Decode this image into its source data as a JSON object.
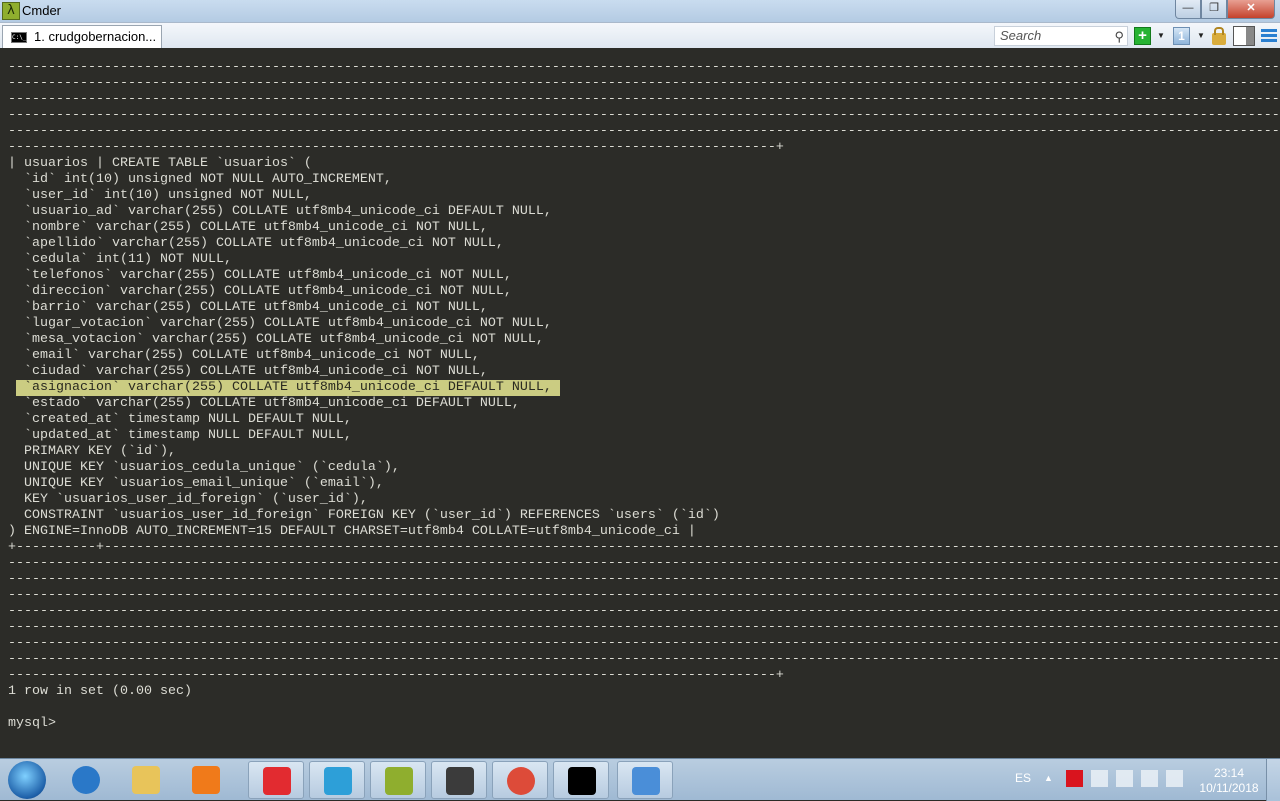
{
  "window": {
    "title": "Cmder",
    "app_icon": "lambda-icon",
    "minimize": "—",
    "maximize": "❐",
    "close": "✕"
  },
  "tabs": [
    {
      "label": "1. crudgobernacion...",
      "icon": "console-icon"
    }
  ],
  "toolbar": {
    "search_placeholder": "Search",
    "search_icon": "⚲",
    "new_console": "+",
    "console_number": "1",
    "caret": "▼"
  },
  "terminal": {
    "highlighted_line": 20,
    "selection_color": "#cbcc82",
    "lines": [
      "----------------------------------------------------------------------------------------------------------------------------------------------------------------",
      "----------------------------------------------------------------------------------------------------------------------------------------------------------------",
      "----------------------------------------------------------------------------------------------------------------------------------------------------------------",
      "----------------------------------------------------------------------------------------------------------------------------------------------------------------",
      "----------------------------------------------------------------------------------------------------------------------------------------------------------------",
      "------------------------------------------------------------------------------------------------+",
      "| usuarios | CREATE TABLE `usuarios` (",
      "  `id` int(10) unsigned NOT NULL AUTO_INCREMENT,",
      "  `user_id` int(10) unsigned NOT NULL,",
      "  `usuario_ad` varchar(255) COLLATE utf8mb4_unicode_ci DEFAULT NULL,",
      "  `nombre` varchar(255) COLLATE utf8mb4_unicode_ci NOT NULL,",
      "  `apellido` varchar(255) COLLATE utf8mb4_unicode_ci NOT NULL,",
      "  `cedula` int(11) NOT NULL,",
      "  `telefonos` varchar(255) COLLATE utf8mb4_unicode_ci NOT NULL,",
      "  `direccion` varchar(255) COLLATE utf8mb4_unicode_ci NOT NULL,",
      "  `barrio` varchar(255) COLLATE utf8mb4_unicode_ci NOT NULL,",
      "  `lugar_votacion` varchar(255) COLLATE utf8mb4_unicode_ci NOT NULL,",
      "  `mesa_votacion` varchar(255) COLLATE utf8mb4_unicode_ci NOT NULL,",
      "  `email` varchar(255) COLLATE utf8mb4_unicode_ci NOT NULL,",
      "  `ciudad` varchar(255) COLLATE utf8mb4_unicode_ci NOT NULL,",
      "  `asignacion` varchar(255) COLLATE utf8mb4_unicode_ci DEFAULT NULL,",
      "  `estado` varchar(255) COLLATE utf8mb4_unicode_ci DEFAULT NULL,",
      "  `created_at` timestamp NULL DEFAULT NULL,",
      "  `updated_at` timestamp NULL DEFAULT NULL,",
      "  PRIMARY KEY (`id`),",
      "  UNIQUE KEY `usuarios_cedula_unique` (`cedula`),",
      "  UNIQUE KEY `usuarios_email_unique` (`email`),",
      "  KEY `usuarios_user_id_foreign` (`user_id`),",
      "  CONSTRAINT `usuarios_user_id_foreign` FOREIGN KEY (`user_id`) REFERENCES `users` (`id`)",
      ") ENGINE=InnoDB AUTO_INCREMENT=15 DEFAULT CHARSET=utf8mb4 COLLATE=utf8mb4_unicode_ci |",
      "+----------+-----------------------------------------------------------------------------------------------------------------------------------------------------",
      "----------------------------------------------------------------------------------------------------------------------------------------------------------------",
      "----------------------------------------------------------------------------------------------------------------------------------------------------------------",
      "----------------------------------------------------------------------------------------------------------------------------------------------------------------",
      "----------------------------------------------------------------------------------------------------------------------------------------------------------------",
      "----------------------------------------------------------------------------------------------------------------------------------------------------------------",
      "----------------------------------------------------------------------------------------------------------------------------------------------------------------",
      "----------------------------------------------------------------------------------------------------------------------------------------------------------------",
      "------------------------------------------------------------------------------------------------+",
      "1 row in set (0.00 sec)",
      "",
      "mysql>"
    ]
  },
  "taskbar": {
    "pinned": [
      {
        "name": "internet-explorer-icon",
        "color": "#2a78c8"
      },
      {
        "name": "file-explorer-icon",
        "color": "#e8c45a"
      },
      {
        "name": "media-player-icon",
        "color": "#f07a1a"
      },
      {
        "name": "vivaldi-icon",
        "color": "#e22b30",
        "running": true
      },
      {
        "name": "mysql-workbench-icon",
        "color": "#2d9fd8",
        "running": true
      },
      {
        "name": "cmder-icon",
        "color": "#8fae2e",
        "running": true
      },
      {
        "name": "sublime-text-icon",
        "color": "#3b3b3b",
        "running": true
      },
      {
        "name": "chrome-icon",
        "color": "#dd4b39",
        "running": true
      },
      {
        "name": "command-prompt-icon",
        "color": "#000000",
        "running": true
      },
      {
        "name": "control-panel-icon",
        "color": "#4a8ed8",
        "running": true
      }
    ],
    "language": "ES",
    "tray_icons": [
      "avira-icon",
      "action-center-icon",
      "power-icon",
      "network-icon",
      "volume-icon"
    ],
    "time": "23:14",
    "date": "10/11/2018"
  }
}
